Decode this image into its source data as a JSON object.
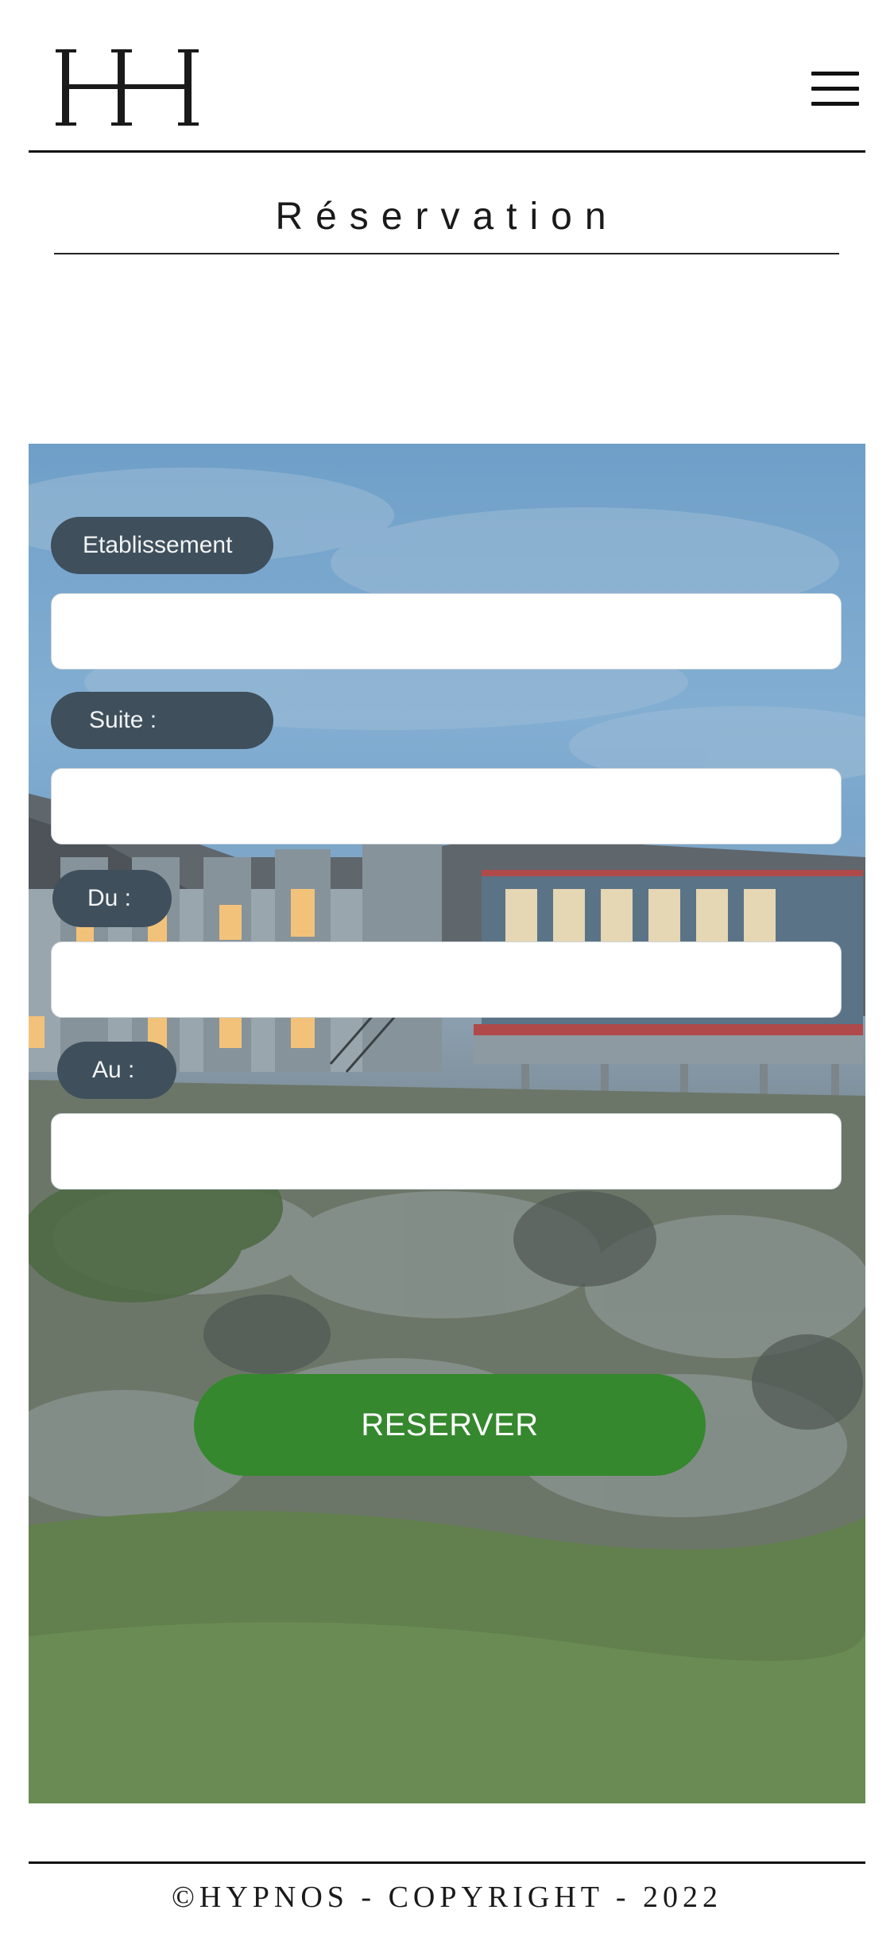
{
  "header": {
    "logo_icon": "hh-monogram-logo",
    "menu_icon": "hamburger-menu-icon"
  },
  "page": {
    "title": "Réservation"
  },
  "form": {
    "fields": [
      {
        "label": "Etablissement :",
        "value": ""
      },
      {
        "label": "Suite :",
        "value": ""
      },
      {
        "label": "Du :",
        "value": ""
      },
      {
        "label": "Au :",
        "value": ""
      }
    ],
    "submit_label": "RESERVER"
  },
  "footer": {
    "copyright": "©HYPNOS - COPYRIGHT - 2022"
  },
  "colors": {
    "label_pill": "#3f4f5c",
    "submit": "#35882d",
    "rules": "#111111"
  }
}
